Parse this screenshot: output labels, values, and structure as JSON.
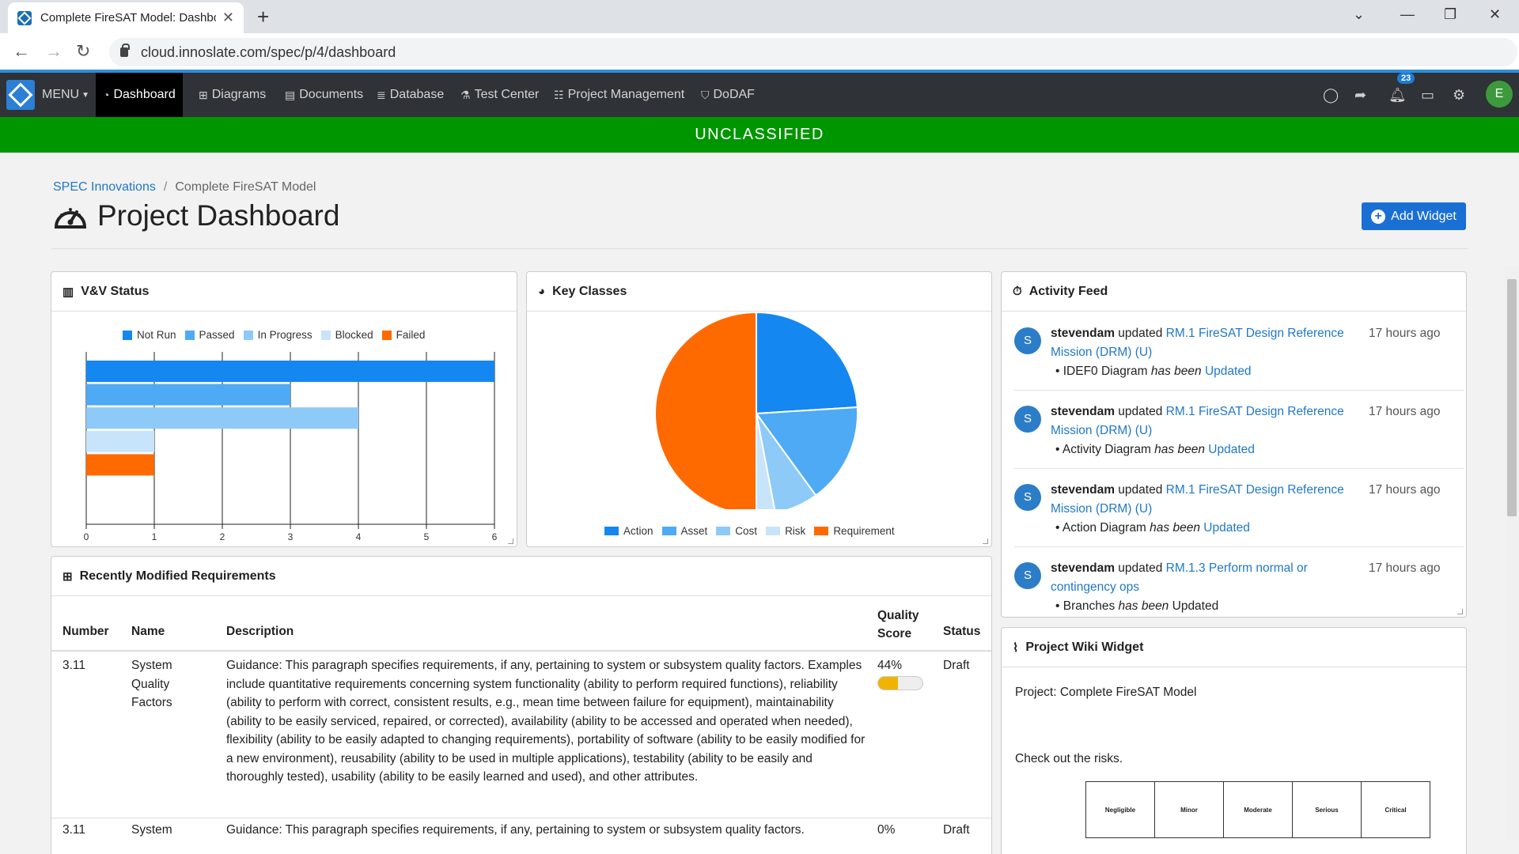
{
  "browser": {
    "tab_title": "Complete FireSAT Model: Dashbo",
    "url": "cloud.innoslate.com/spec/p/4/dashboard"
  },
  "nav": {
    "menu": "MENU",
    "items": [
      {
        "label": "Dashboard",
        "icon": "gauge-icon"
      },
      {
        "label": "Diagrams",
        "icon": "diagram-icon"
      },
      {
        "label": "Documents",
        "icon": "document-icon"
      },
      {
        "label": "Database",
        "icon": "database-icon"
      },
      {
        "label": "Test Center",
        "icon": "flask-icon"
      },
      {
        "label": "Project Management",
        "icon": "checklist-icon"
      },
      {
        "label": "DoDAF",
        "icon": "shield-icon"
      }
    ],
    "notification_count": "23",
    "avatar_initial": "E"
  },
  "classification": "UNCLASSIFIED",
  "breadcrumb": {
    "root": "SPEC Innovations",
    "current": "Complete FireSAT Model"
  },
  "page": {
    "title": "Project Dashboard",
    "add_widget": "Add Widget"
  },
  "vv_status": {
    "title": "V&V Status",
    "colors": {
      "not_run": "#1587f0",
      "passed": "#4eaaf5",
      "in_progress": "#8ecaf8",
      "blocked": "#c8e4fb",
      "failed": "#ff6a00"
    }
  },
  "key_classes": {
    "title": "Key Classes"
  },
  "chart_data": [
    {
      "type": "bar",
      "orientation": "horizontal",
      "title": "V&V Status",
      "categories": [
        "Not Run",
        "Passed",
        "In Progress",
        "Blocked",
        "Failed"
      ],
      "values": [
        6,
        3,
        4,
        1,
        1
      ],
      "xlim": [
        0,
        6
      ],
      "xticks": [
        "0",
        "1",
        "2",
        "3",
        "4",
        "5",
        "6"
      ],
      "legend": "top",
      "grid": true
    },
    {
      "type": "pie",
      "title": "Key Classes",
      "categories": [
        "Action",
        "Asset",
        "Cost",
        "Risk",
        "Requirement"
      ],
      "values": [
        24,
        16,
        7,
        3,
        50
      ],
      "colors": [
        "#1587f0",
        "#4eaaf5",
        "#8ecaf8",
        "#c8e4fb",
        "#ff6a00"
      ],
      "legend": "bottom"
    }
  ],
  "activity": {
    "title": "Activity Feed",
    "items": [
      {
        "initial": "S",
        "user": "stevendam",
        "verb": " updated ",
        "link": "RM.1 FireSAT Design Reference Mission (DRM) (U)",
        "time": "17 hours ago",
        "detail_item": "IDEF0 Diagram",
        "detail_mid": " has been ",
        "detail_status": "Updated",
        "status_link": true
      },
      {
        "initial": "S",
        "user": "stevendam",
        "verb": " updated ",
        "link": "RM.1 FireSAT Design Reference Mission (DRM) (U)",
        "time": "17 hours ago",
        "detail_item": "Activity Diagram",
        "detail_mid": " has been ",
        "detail_status": "Updated",
        "status_link": true
      },
      {
        "initial": "S",
        "user": "stevendam",
        "verb": " updated ",
        "link": "RM.1 FireSAT Design Reference Mission (DRM) (U)",
        "time": "17 hours ago",
        "detail_item": "Action Diagram",
        "detail_mid": " has been ",
        "detail_status": "Updated",
        "status_link": true
      },
      {
        "initial": "S",
        "user": "stevendam",
        "verb": " updated ",
        "link": "RM.1.3 Perform normal or contingency ops",
        "time": "17 hours ago",
        "detail_item": "Branches",
        "detail_mid": " has been ",
        "detail_status": "Updated",
        "status_link": false
      }
    ]
  },
  "requirements": {
    "title": "Recently Modified Requirements",
    "columns": [
      "Number",
      "Name",
      "Description",
      "Quality Score",
      "Status"
    ],
    "rows": [
      {
        "number": "3.11",
        "name": "System Quality Factors",
        "description": "Guidance: This paragraph specifies requirements, if any, pertaining to system or subsystem quality factors. Examples include quantitative requirements concerning system functionality (ability to perform required functions), reliability (ability to perform with correct, consistent results, e.g., mean time between failure for equipment), maintainability (ability to be easily serviced, repaired, or corrected), availability (ability to be accessed and operated when needed), flexibility (ability to be easily adapted to changing requirements), portability of software (ability to be easily modified for a new environment), reusability (ability to be used in multiple applications), testability (ability to be easily and thoroughly tested), usability (ability to be easily learned and used), and other attributes.",
        "quality": "44%",
        "quality_value": 0.44,
        "status": "Draft"
      },
      {
        "number": "3.11",
        "name": "System",
        "description": "Guidance: This paragraph specifies requirements, if any, pertaining to system or subsystem quality factors.",
        "quality": "0%",
        "quality_value": 0,
        "status": "Draft"
      }
    ]
  },
  "wiki": {
    "title": "Project Wiki Widget",
    "project_line": "Project: Complete FireSAT Model",
    "risk_line": "Check out the risks.",
    "risk_columns": [
      "Negligible",
      "Minor",
      "Moderate",
      "Serious",
      "Critical"
    ]
  }
}
